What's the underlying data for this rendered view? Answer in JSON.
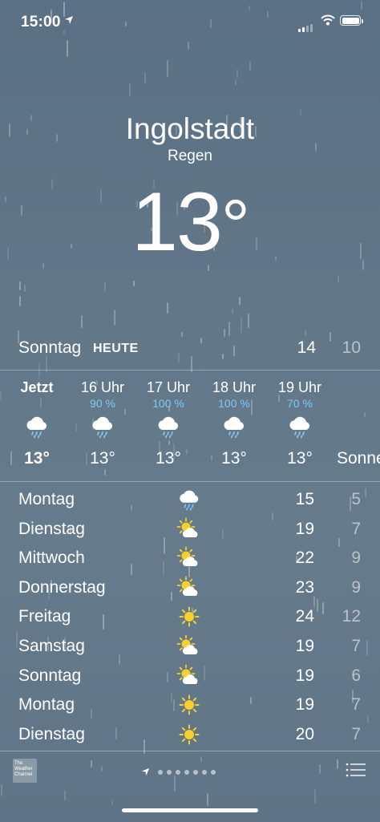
{
  "status_bar": {
    "time": "15:00"
  },
  "location": {
    "city": "Ingolstadt",
    "condition": "Regen",
    "temperature": "13",
    "degree": "°"
  },
  "today": {
    "day": "Sonntag",
    "tag": "HEUTE",
    "high": "14",
    "low": "10"
  },
  "hourly": [
    {
      "label": "Jetzt",
      "pct": "",
      "icon": "rain-cloud-icon",
      "temp": "13°",
      "bold": true
    },
    {
      "label": "16 Uhr",
      "pct": "90 %",
      "icon": "rain-cloud-icon",
      "temp": "13°",
      "bold": false
    },
    {
      "label": "17 Uhr",
      "pct": "100 %",
      "icon": "rain-cloud-icon",
      "temp": "13°",
      "bold": false
    },
    {
      "label": "18 Uhr",
      "pct": "100 %",
      "icon": "rain-cloud-icon",
      "temp": "13°",
      "bold": false
    },
    {
      "label": "19 Uhr",
      "pct": "70 %",
      "icon": "rain-cloud-icon",
      "temp": "13°",
      "bold": false
    },
    {
      "label": "",
      "pct": "",
      "icon": "",
      "temp": "Sonne",
      "bold": false
    }
  ],
  "daily": [
    {
      "day": "Montag",
      "icon": "rain-cloud-icon",
      "high": "15",
      "low": "5"
    },
    {
      "day": "Dienstag",
      "icon": "partly-sunny-icon",
      "high": "19",
      "low": "7"
    },
    {
      "day": "Mittwoch",
      "icon": "partly-sunny-icon",
      "high": "22",
      "low": "9"
    },
    {
      "day": "Donnerstag",
      "icon": "partly-sunny-icon",
      "high": "23",
      "low": "9"
    },
    {
      "day": "Freitag",
      "icon": "sun-icon",
      "high": "24",
      "low": "12"
    },
    {
      "day": "Samstag",
      "icon": "partly-sunny-icon",
      "high": "19",
      "low": "7"
    },
    {
      "day": "Sonntag",
      "icon": "partly-sunny-icon",
      "high": "19",
      "low": "6"
    },
    {
      "day": "Montag",
      "icon": "sun-icon",
      "high": "19",
      "low": "7"
    },
    {
      "day": "Dienstag",
      "icon": "sun-icon",
      "high": "20",
      "low": "7"
    }
  ],
  "footer": {
    "brand": "The Weather Channel",
    "page_count": "8"
  },
  "colors": {
    "precip": "#7ec8f5",
    "sun": "#f7d02c",
    "background": "#617788"
  }
}
